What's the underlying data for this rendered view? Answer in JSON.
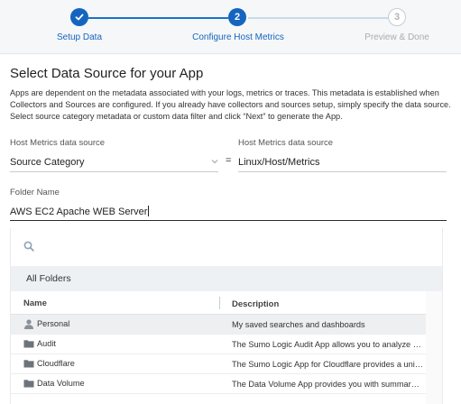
{
  "stepper": {
    "steps": [
      {
        "label": "Setup Data",
        "marker": "✓",
        "state": "done"
      },
      {
        "label": "Configure Host Metrics",
        "marker": "2",
        "state": "active"
      },
      {
        "label": "Preview & Done",
        "marker": "3",
        "state": "todo"
      }
    ]
  },
  "main": {
    "title": "Select Data Source for your App",
    "description": "Apps are dependent on the metadata associated with your logs, metrics or traces. This metadata is established when Collectors and Sources are configured. If you already have collectors and sources setup, simply specify the data source. Select source category metadata or custom data filter and click “Next” to generate the App."
  },
  "form": {
    "source_label_left": "Host Metrics data source",
    "source_select_value": "Source Category",
    "equals": "=",
    "source_label_right": "Host Metrics data source",
    "source_value": "Linux/Host/Metrics",
    "folder_label": "Folder Name",
    "folder_value": "AWS EC2 Apache WEB Server"
  },
  "browser": {
    "all_folders": "All Folders",
    "columns": {
      "name": "Name",
      "description": "Description"
    },
    "rows": [
      {
        "name": "Personal",
        "icon": "person-icon",
        "description": "My saved searches and dashboards",
        "selected": true
      },
      {
        "name": "Audit",
        "icon": "folder-icon",
        "description": "The Sumo Logic Audit App allows you to analyze and report on account activity",
        "selected": false
      },
      {
        "name": "Cloudflare",
        "icon": "folder-icon",
        "description": "The Sumo Logic App for Cloudflare provides a unified view of your traffic",
        "selected": false
      },
      {
        "name": "Data Volume",
        "icon": "folder-icon",
        "description": "The Data Volume App provides you with summary of your data usage",
        "selected": false
      }
    ]
  },
  "colors": {
    "accent": "#1565c0",
    "stepper_bg": "#f6f7f8",
    "selected_row": "#edeff1",
    "all_folders_bg": "#eef1f4"
  }
}
